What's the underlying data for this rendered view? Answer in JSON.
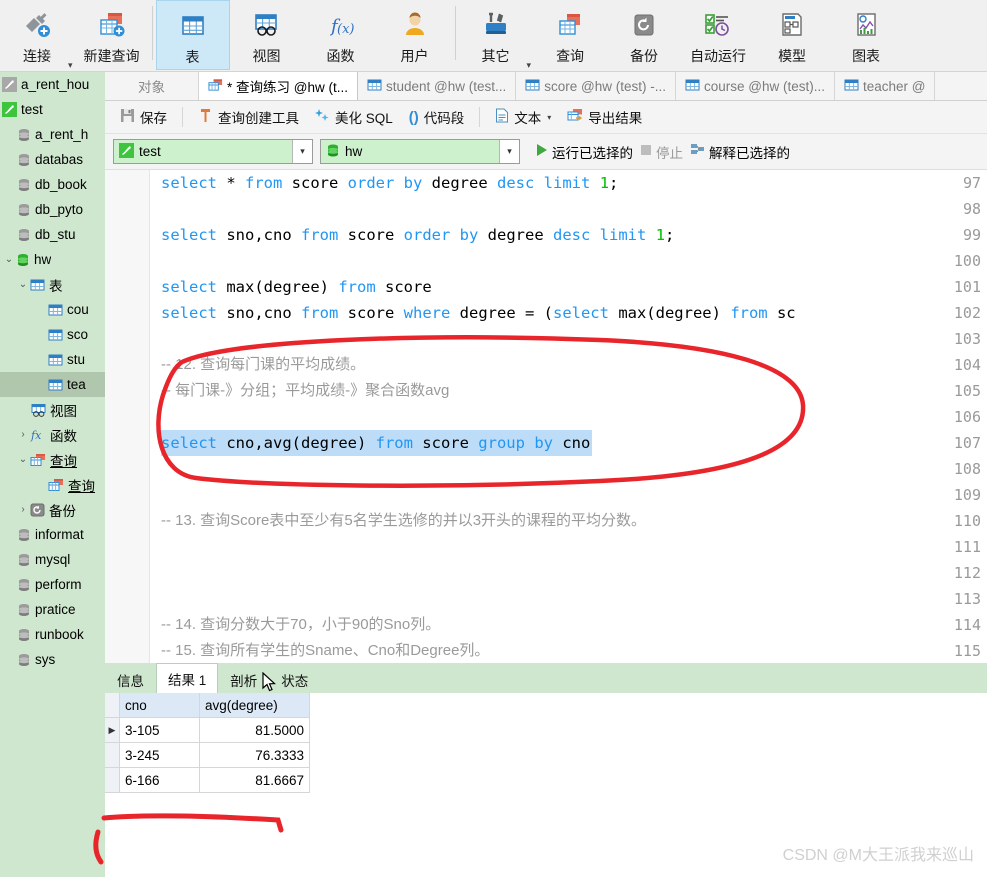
{
  "ribbon": {
    "items": [
      {
        "label": "连接",
        "icon": "connect-icon",
        "caret": true,
        "selected": false
      },
      {
        "label": "新建查询",
        "icon": "new-query-icon",
        "caret": false,
        "selected": false
      },
      {
        "label": "表",
        "icon": "table-icon",
        "caret": false,
        "selected": true
      },
      {
        "label": "视图",
        "icon": "view-icon",
        "caret": false,
        "selected": false
      },
      {
        "label": "函数",
        "icon": "function-icon",
        "caret": false,
        "selected": false
      },
      {
        "label": "用户",
        "icon": "user-icon",
        "caret": false,
        "selected": false
      },
      {
        "label": "其它",
        "icon": "other-tools-icon",
        "caret": true,
        "selected": false
      },
      {
        "label": "查询",
        "icon": "query-icon",
        "caret": false,
        "selected": false
      },
      {
        "label": "备份",
        "icon": "backup-icon",
        "caret": false,
        "selected": false
      },
      {
        "label": "自动运行",
        "icon": "automation-icon",
        "caret": false,
        "selected": false
      },
      {
        "label": "模型",
        "icon": "model-icon",
        "caret": false,
        "selected": false
      },
      {
        "label": "图表",
        "icon": "chart-icon",
        "caret": false,
        "selected": false
      }
    ]
  },
  "sidebar": {
    "items": [
      {
        "label": "a_rent_hou",
        "icon": "connection-icon",
        "indent": 0,
        "twisty": "",
        "selected": false
      },
      {
        "label": "test",
        "icon": "connection-active-icon",
        "indent": 0,
        "twisty": "",
        "selected": false
      },
      {
        "label": "a_rent_h",
        "icon": "database-icon",
        "indent": 1,
        "twisty": "",
        "selected": false
      },
      {
        "label": "databas",
        "icon": "database-icon",
        "indent": 1,
        "twisty": "",
        "selected": false
      },
      {
        "label": "db_book",
        "icon": "database-icon",
        "indent": 1,
        "twisty": "",
        "selected": false
      },
      {
        "label": "db_pyto",
        "icon": "database-icon",
        "indent": 1,
        "twisty": "",
        "selected": false
      },
      {
        "label": "db_stu",
        "icon": "database-icon",
        "indent": 1,
        "twisty": "",
        "selected": false
      },
      {
        "label": "hw",
        "icon": "database-open-icon",
        "indent": 1,
        "twisty": "v",
        "selected": false
      },
      {
        "label": "表",
        "icon": "table-folder-icon",
        "indent": 2,
        "twisty": "v",
        "selected": false
      },
      {
        "label": "cou",
        "icon": "table-item-icon",
        "indent": 3,
        "twisty": "",
        "selected": false
      },
      {
        "label": "sco",
        "icon": "table-item-icon",
        "indent": 3,
        "twisty": "",
        "selected": false
      },
      {
        "label": "stu",
        "icon": "table-item-icon",
        "indent": 3,
        "twisty": "",
        "selected": false
      },
      {
        "label": "tea",
        "icon": "table-item-icon",
        "indent": 3,
        "twisty": "",
        "selected": true
      },
      {
        "label": "视图",
        "icon": "view-folder-icon",
        "indent": 2,
        "twisty": "",
        "selected": false
      },
      {
        "label": "函数",
        "icon": "function-folder-icon",
        "indent": 2,
        "twisty": ">",
        "selected": false
      },
      {
        "label": "查询",
        "icon": "query-folder-icon",
        "indent": 2,
        "twisty": "v",
        "selected": false
      },
      {
        "label": "查询",
        "icon": "query-item-icon",
        "indent": 3,
        "twisty": "",
        "selected": false
      },
      {
        "label": "备份",
        "icon": "backup-folder-icon",
        "indent": 2,
        "twisty": ">",
        "selected": false
      },
      {
        "label": "informat",
        "icon": "database-icon",
        "indent": 1,
        "twisty": "",
        "selected": false
      },
      {
        "label": "mysql",
        "icon": "database-icon",
        "indent": 1,
        "twisty": "",
        "selected": false
      },
      {
        "label": "perform",
        "icon": "database-icon",
        "indent": 1,
        "twisty": "",
        "selected": false
      },
      {
        "label": "pratice",
        "icon": "database-icon",
        "indent": 1,
        "twisty": "",
        "selected": false
      },
      {
        "label": "runbook",
        "icon": "database-icon",
        "indent": 1,
        "twisty": "",
        "selected": false
      },
      {
        "label": "sys",
        "icon": "database-icon",
        "indent": 1,
        "twisty": "",
        "selected": false
      }
    ]
  },
  "tabs": {
    "object_label": "对象",
    "items": [
      {
        "label": "* 查询练习 @hw (t...",
        "icon": "query-tab-icon",
        "active": true
      },
      {
        "label": "student @hw (test...",
        "icon": "table-tab-icon",
        "active": false
      },
      {
        "label": "score @hw (test) -...",
        "icon": "table-tab-icon",
        "active": false
      },
      {
        "label": "course @hw (test)...",
        "icon": "table-tab-icon",
        "active": false
      },
      {
        "label": "teacher @",
        "icon": "table-tab-icon",
        "active": false
      }
    ]
  },
  "editor_toolbar": {
    "groups": [
      [
        {
          "label": "保存",
          "icon": "save-icon",
          "caret": false
        }
      ],
      [
        {
          "label": "查询创建工具",
          "icon": "query-builder-icon",
          "caret": false
        },
        {
          "label": "美化 SQL",
          "icon": "beautify-icon",
          "caret": false
        },
        {
          "label": "代码段",
          "icon": "snippet-icon",
          "caret": false
        }
      ],
      [
        {
          "label": "文本",
          "icon": "text-icon",
          "caret": true
        },
        {
          "label": "导出结果",
          "icon": "export-icon",
          "caret": false
        }
      ]
    ]
  },
  "runbar": {
    "connection": "test",
    "database": "hw",
    "run_label": "运行已选择的",
    "stop_label": "停止",
    "explain_label": "解释已选择的"
  },
  "editor": {
    "first_line_number": 97,
    "lines": [
      {
        "n": 97,
        "type": "sql",
        "text": "select * from score order by degree desc limit 1;"
      },
      {
        "n": 98,
        "type": "blank",
        "text": ""
      },
      {
        "n": 99,
        "type": "sql",
        "text": "select sno,cno from score order by degree desc limit 1;"
      },
      {
        "n": 100,
        "type": "blank",
        "text": ""
      },
      {
        "n": 101,
        "type": "sql",
        "text": "select max(degree) from score"
      },
      {
        "n": 102,
        "type": "sql",
        "text": "select sno,cno from score where degree = (select max(degree) from sc"
      },
      {
        "n": 103,
        "type": "blank",
        "text": ""
      },
      {
        "n": 104,
        "type": "comment",
        "text": "-- 12. 查询每门课的平均成绩。"
      },
      {
        "n": 105,
        "type": "comment",
        "text": "-- 每门课-》分组；平均成绩-》聚合函数avg"
      },
      {
        "n": 106,
        "type": "blank",
        "text": ""
      },
      {
        "n": 107,
        "type": "sql-selected",
        "text": "select cno,avg(degree) from score group by cno"
      },
      {
        "n": 108,
        "type": "blank",
        "text": ""
      },
      {
        "n": 109,
        "type": "blank",
        "text": ""
      },
      {
        "n": 110,
        "type": "comment",
        "text": "-- 13. 查询Score表中至少有5名学生选修的并以3开头的课程的平均分数。"
      },
      {
        "n": 111,
        "type": "blank",
        "text": ""
      },
      {
        "n": 112,
        "type": "blank",
        "text": ""
      },
      {
        "n": 113,
        "type": "blank",
        "text": ""
      },
      {
        "n": 114,
        "type": "comment",
        "text": "-- 14. 查询分数大于70，小于90的Sno列。"
      },
      {
        "n": 115,
        "type": "comment",
        "text": "-- 15. 查询所有学生的Sname、Cno和Degree列。"
      }
    ]
  },
  "results": {
    "tabs": [
      {
        "label": "信息",
        "active": false
      },
      {
        "label": "结果 1",
        "active": true
      },
      {
        "label": "剖析",
        "active": false
      },
      {
        "label": "状态",
        "active": false
      }
    ],
    "columns": [
      "cno",
      "avg(degree)"
    ],
    "rows": [
      {
        "marker": "▶",
        "cno": "3-105",
        "avg": "81.5000"
      },
      {
        "marker": "",
        "cno": "3-245",
        "avg": "76.3333"
      },
      {
        "marker": "",
        "cno": "6-166",
        "avg": "81.6667"
      }
    ]
  },
  "watermark": "CSDN @M大王派我来巡山",
  "colors": {
    "accent_blue": "#2196f3",
    "sidebar_green": "#cfe7cf",
    "annotation_red": "#e8252b",
    "selection_blue": "#bcdcf7",
    "ribbon_selected": "#cde8f7"
  }
}
